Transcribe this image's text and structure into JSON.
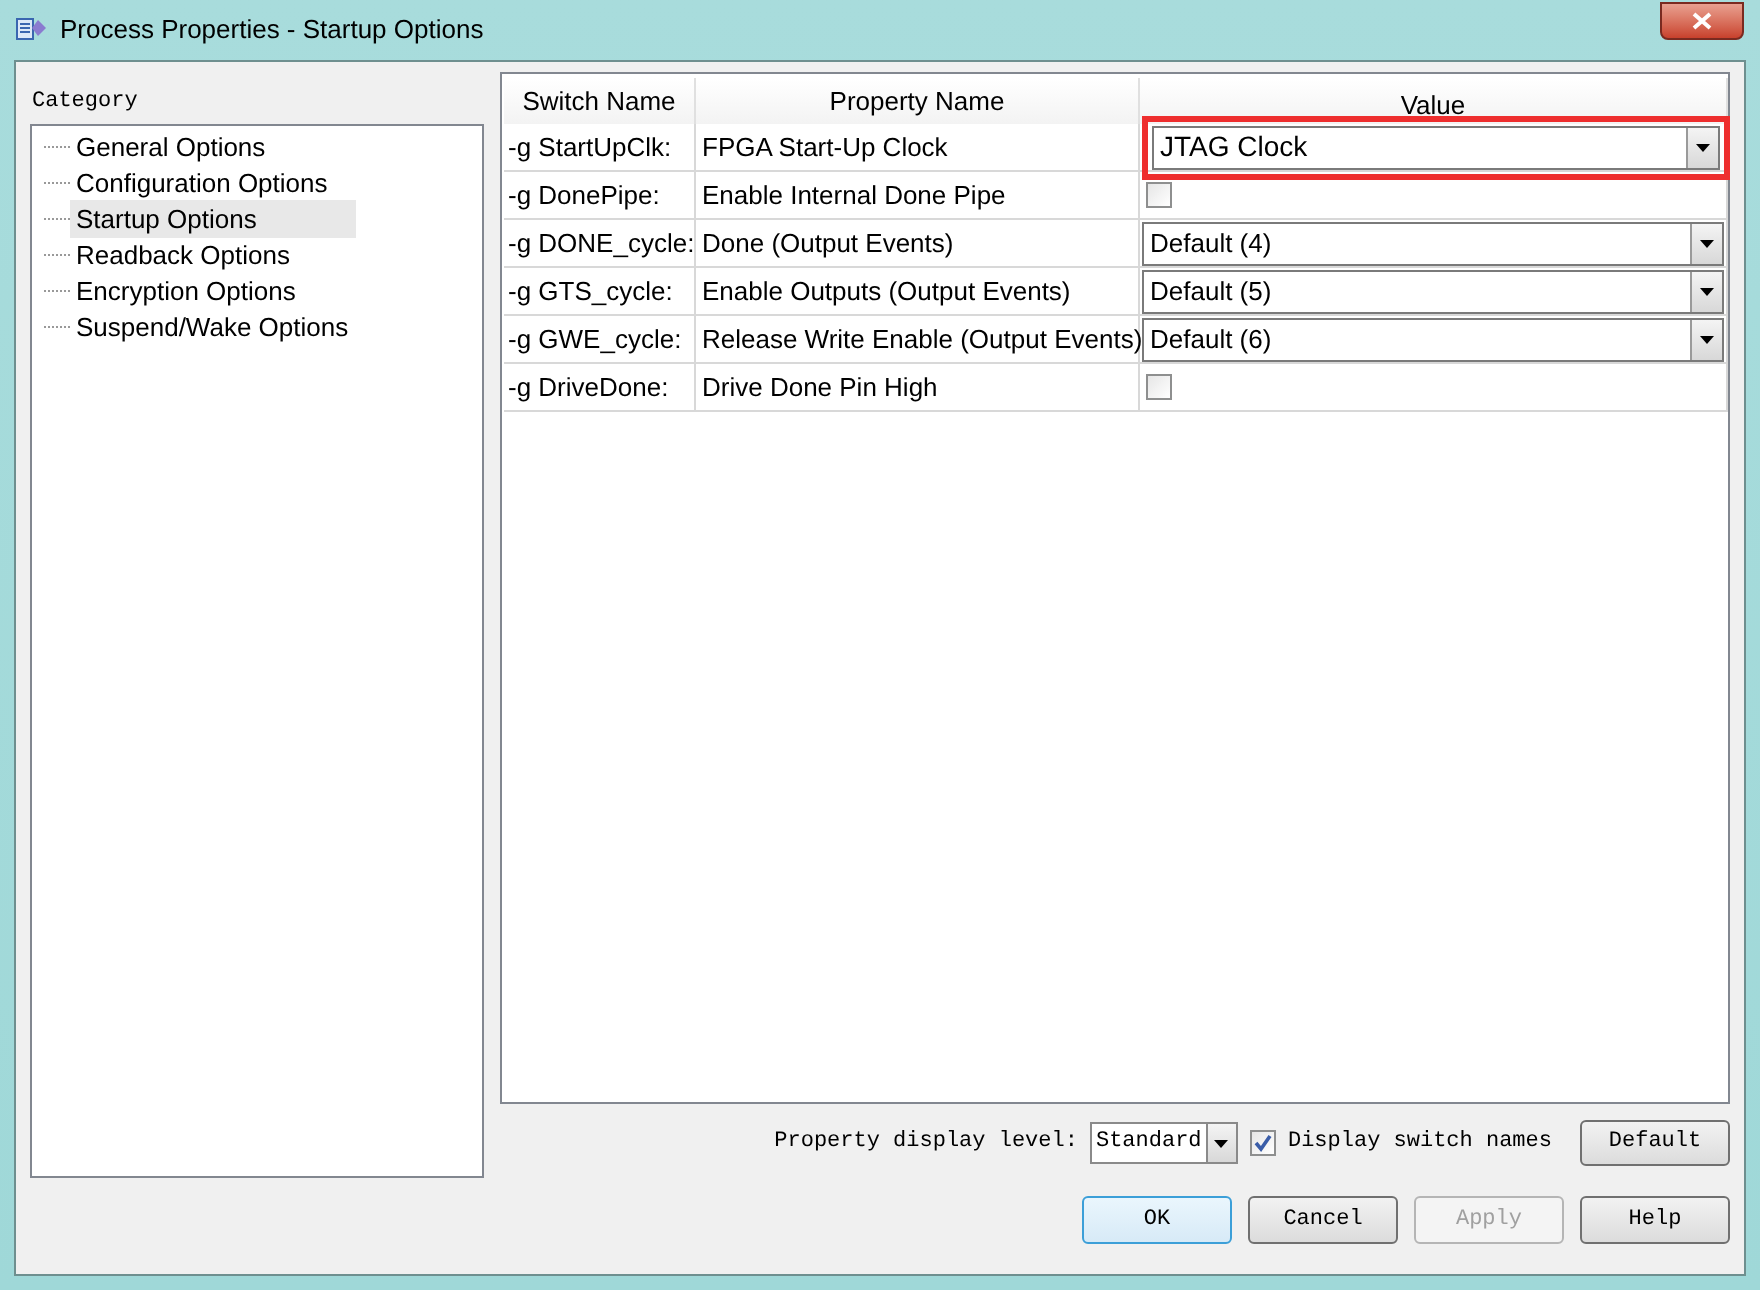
{
  "window": {
    "title": "Process Properties - Startup Options"
  },
  "category": {
    "label": "Category",
    "items": [
      {
        "label": "General Options",
        "selected": false
      },
      {
        "label": "Configuration Options",
        "selected": false
      },
      {
        "label": "Startup Options",
        "selected": true
      },
      {
        "label": "Readback Options",
        "selected": false
      },
      {
        "label": "Encryption Options",
        "selected": false
      },
      {
        "label": "Suspend/Wake Options",
        "selected": false
      }
    ]
  },
  "table": {
    "columns": [
      "Switch Name",
      "Property Name",
      "Value"
    ],
    "rows": [
      {
        "switch": "-g StartUpClk:",
        "property": "FPGA Start-Up Clock",
        "kind": "combo",
        "value": "JTAG Clock",
        "highlighted": true
      },
      {
        "switch": "-g DonePipe:",
        "property": "Enable Internal Done Pipe",
        "kind": "checkbox",
        "checked": false,
        "highlighted": false
      },
      {
        "switch": "-g DONE_cycle:",
        "property": "Done (Output Events)",
        "kind": "combo",
        "value": "Default (4)",
        "highlighted": false
      },
      {
        "switch": "-g GTS_cycle:",
        "property": "Enable Outputs (Output Events)",
        "kind": "combo",
        "value": "Default (5)",
        "highlighted": false
      },
      {
        "switch": "-g GWE_cycle:",
        "property": "Release Write Enable (Output Events)",
        "kind": "combo",
        "value": "Default (6)",
        "highlighted": false
      },
      {
        "switch": "-g DriveDone:",
        "property": "Drive Done Pin High",
        "kind": "checkbox",
        "checked": false,
        "highlighted": false
      }
    ]
  },
  "display_level": {
    "label": "Property display level:",
    "value": "Standard"
  },
  "display_switch_names": {
    "label": "Display switch names",
    "checked": true
  },
  "default_button": "Default",
  "buttons": [
    {
      "label": "OK",
      "disabled": false,
      "focused": true
    },
    {
      "label": "Cancel",
      "disabled": false,
      "focused": false
    },
    {
      "label": "Apply",
      "disabled": true,
      "focused": false
    },
    {
      "label": "Help",
      "disabled": false,
      "focused": false
    }
  ]
}
